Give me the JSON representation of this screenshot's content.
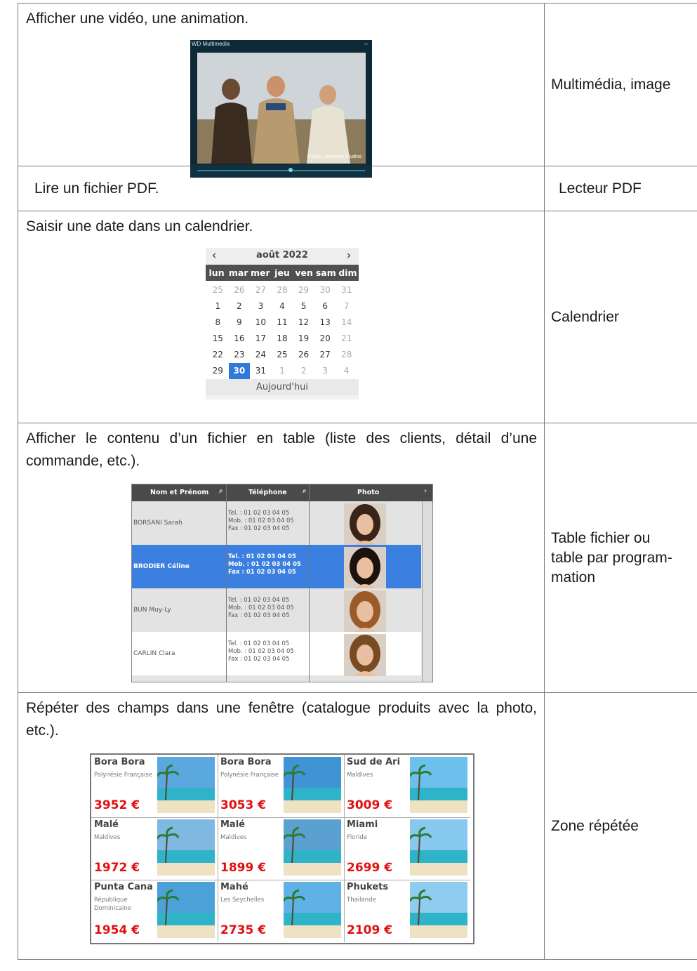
{
  "rows": [
    {
      "description": "Afficher une vidéo, une animation.",
      "feature": "Multimédia, image"
    },
    {
      "description": "Lire un fichier PDF.",
      "feature": "Lecteur PDF"
    },
    {
      "description": "Saisir une date dans un calendrier.",
      "feature": "Calendrier"
    },
    {
      "description": "Afficher le contenu d’un fichier en table (liste des clients, détail d’une commande, etc.).",
      "feature": "Table fichier ou table par program-mation"
    },
    {
      "description": "Répéter des champs dans une fenêtre (catalogue produits avec la photo, etc.).",
      "feature": "Zone répétée"
    }
  ],
  "multimedia": {
    "window_title": "WD Multimedia",
    "credit": "©1999 Universal Studios"
  },
  "calendar": {
    "title": "août 2022",
    "prev_icon": "chevron-left-icon",
    "next_icon": "chevron-right-icon",
    "weekdays": [
      "lun",
      "mar",
      "mer",
      "jeu",
      "ven",
      "sam",
      "dim"
    ],
    "weeks": [
      [
        "25",
        "26",
        "27",
        "28",
        "29",
        "30",
        "31"
      ],
      [
        "1",
        "2",
        "3",
        "4",
        "5",
        "6",
        "7"
      ],
      [
        "8",
        "9",
        "10",
        "11",
        "12",
        "13",
        "14"
      ],
      [
        "15",
        "16",
        "17",
        "18",
        "19",
        "20",
        "21"
      ],
      [
        "22",
        "23",
        "24",
        "25",
        "26",
        "27",
        "28"
      ],
      [
        "29",
        "30",
        "31",
        "1",
        "2",
        "3",
        "4"
      ]
    ],
    "selected": "30",
    "today_label": "Aujourd'hui"
  },
  "file_table": {
    "headers": [
      "Nom et Prénom",
      "Téléphone",
      "Photo"
    ],
    "rows": [
      {
        "name": "BORSANI Sarah",
        "tel": "Tel. : 01 02 03 04 05",
        "mob": "Mob. : 01 02 03 04 05",
        "fax": "Fax : 01 02 03 04 05",
        "selected": false,
        "hair": "#3a2418"
      },
      {
        "name": "BRODIER Céline",
        "tel": "Tel. : 01 02 03 04 05",
        "mob": "Mob. : 01 02 03 04 05",
        "fax": "Fax : 01 02 03 04 05",
        "selected": true,
        "hair": "#1c120c"
      },
      {
        "name": "BUN Muy-Ly",
        "tel": "Tel. : 01 02 03 04 05",
        "mob": "Mob. : 01 02 03 04 05",
        "fax": "Fax : 01 02 03 04 05",
        "selected": false,
        "hair": "#9a5a2a"
      },
      {
        "name": "CARLIN Clara",
        "tel": "Tel. : 01 02 03 04 05",
        "mob": "Mob. : 01 02 03 04 05",
        "fax": "Fax : 01 02 03 04 05",
        "selected": false,
        "hair": "#7a4a22"
      }
    ],
    "selection_color": "#3b7fe0"
  },
  "repeated_zone": {
    "items": [
      {
        "name": "Bora Bora",
        "region": "Polynésie Française",
        "price": "3952 €"
      },
      {
        "name": "Bora Bora",
        "region": "Polynésie Française",
        "price": "3053 €"
      },
      {
        "name": "Sud de Ari",
        "region": "Maldives",
        "price": "3009 €"
      },
      {
        "name": "Malé",
        "region": "Maldives",
        "price": "1972 €"
      },
      {
        "name": "Malé",
        "region": "Maldives",
        "price": "1899 €"
      },
      {
        "name": "Miami",
        "region": "Floride",
        "price": "2699 €"
      },
      {
        "name": "Punta Cana",
        "region": "République Dominicaine",
        "price": "1954 €"
      },
      {
        "name": "Mahé",
        "region": "Les Seychelles",
        "price": "2735 €"
      },
      {
        "name": "Phukets",
        "region": "Thailande",
        "price": "2109 €"
      }
    ],
    "price_color": "#e21010"
  }
}
